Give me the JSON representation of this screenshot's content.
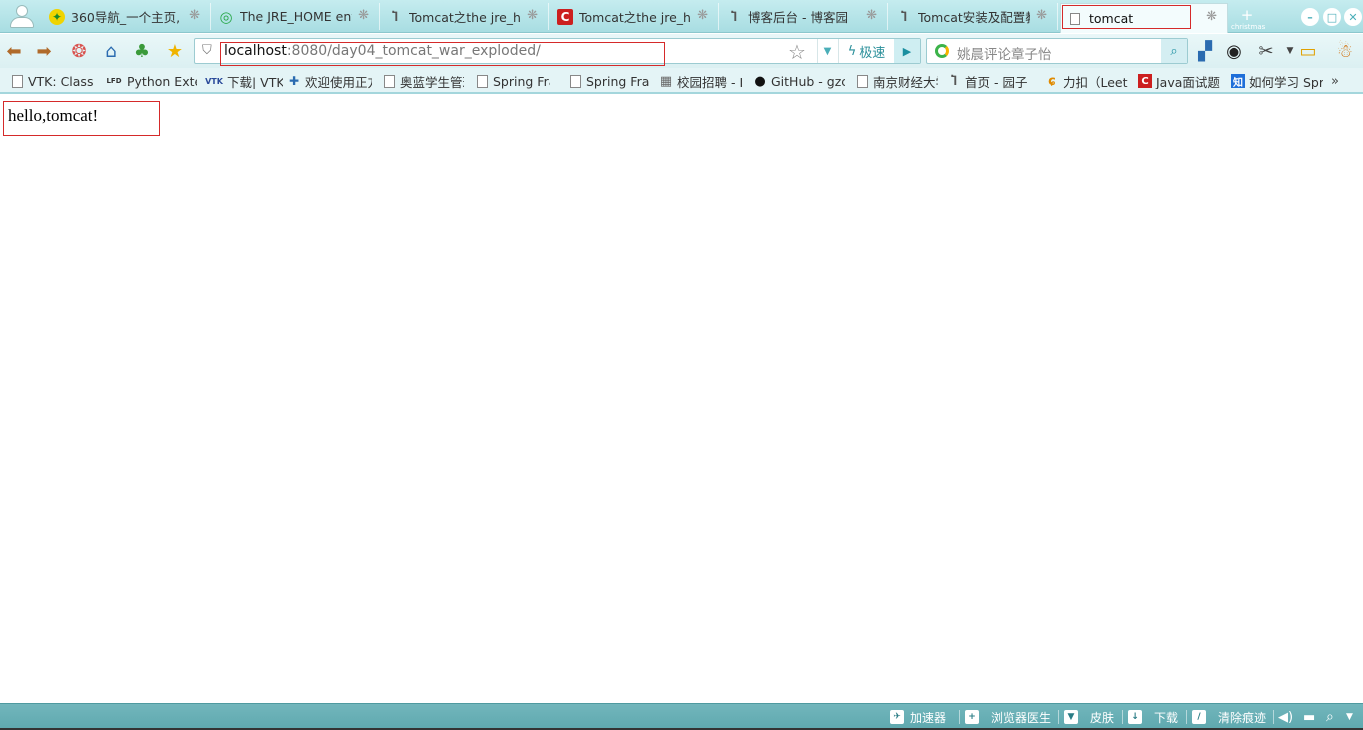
{
  "tabs": [
    {
      "title": "360导航_一个主页,",
      "icon": "360-nav-icon",
      "favicon_char": "✦",
      "favicon_bg": "#f0d400",
      "favicon_color": "#1a8a2a"
    },
    {
      "title": "The JRE_HOME env",
      "icon": "search-engine-icon",
      "favicon_char": "◎",
      "favicon_bg": "#ffffff",
      "favicon_color": "#2aa84a"
    },
    {
      "title": "Tomcat之the jre_ho",
      "icon": "cnblogs-icon",
      "favicon_char": "Ⴈ",
      "favicon_bg": "#ffffff",
      "favicon_color": "#555555"
    },
    {
      "title": "Tomcat之the jre_ho",
      "icon": "csdn-icon",
      "favicon_char": "C",
      "favicon_bg": "#cc1f1f",
      "favicon_color": "#ffffff"
    },
    {
      "title": "博客后台 - 博客园",
      "icon": "cnblogs-icon",
      "favicon_char": "Ⴈ",
      "favicon_bg": "#ffffff",
      "favicon_color": "#555555"
    },
    {
      "title": "Tomcat安装及配置教",
      "icon": "cnblogs-icon",
      "favicon_char": "Ⴈ",
      "favicon_bg": "#ffffff",
      "favicon_color": "#555555"
    },
    {
      "title": "tomcat",
      "icon": "page-icon",
      "favicon_char": "",
      "favicon_bg": "#ffffff",
      "favicon_color": "#888888",
      "active": true
    }
  ],
  "tab_close_glyph": "❋",
  "new_tab": {
    "glyph": "+",
    "caption": "christmas"
  },
  "address": {
    "host": "localhost",
    "rest": ":8080/day04_tomcat_war_exploded/",
    "speed_label": "极速"
  },
  "search": {
    "placeholder": "姚晨评论章子怡"
  },
  "bookmarks": [
    {
      "label": "VTK: Class I",
      "icon": "doc-icon"
    },
    {
      "label": "Python Exter",
      "icon": "lfd-icon",
      "badge": "LFD"
    },
    {
      "label": "下载| VTK",
      "icon": "vtk-icon",
      "badge": "VTK"
    },
    {
      "label": "欢迎使用正方",
      "icon": "box-icon",
      "badge": "✚"
    },
    {
      "label": "奥蓝学生管理",
      "icon": "doc-icon"
    },
    {
      "label": "Spring Fran",
      "icon": "doc-icon"
    },
    {
      "label": "Spring Fran",
      "icon": "doc-icon"
    },
    {
      "label": "校园招聘 - I",
      "icon": "image-icon",
      "badge": "▦"
    },
    {
      "label": "GitHub - gzc",
      "icon": "github-icon",
      "badge": "●"
    },
    {
      "label": "南京财经大学",
      "icon": "doc-icon"
    },
    {
      "label": "首页 - 园子",
      "icon": "cnblogs-icon",
      "badge": "Ⴈ"
    },
    {
      "label": "力扣（Leet(",
      "icon": "leetcode-icon",
      "badge": "ɕ"
    },
    {
      "label": "Java面试题",
      "icon": "csdn-icon",
      "badge": "C"
    },
    {
      "label": "如何学习 Spr",
      "icon": "zhihu-icon",
      "badge": "知"
    }
  ],
  "bookmarks_more": "»",
  "page": {
    "text": "hello,tomcat!"
  },
  "status": [
    {
      "label": "加速器",
      "icon": "rocket-icon",
      "glyph": "✈"
    },
    {
      "label": "浏览器医生",
      "icon": "doctor-icon",
      "glyph": "+"
    },
    {
      "label": "皮肤",
      "icon": "skin-icon",
      "glyph": "▼"
    },
    {
      "label": "下载",
      "icon": "download-icon",
      "glyph": "↓"
    },
    {
      "label": "清除痕迹",
      "icon": "broom-icon",
      "glyph": "/"
    }
  ],
  "colors": {
    "highlight": "#d52a2a",
    "accent": "#4aaeb8"
  }
}
